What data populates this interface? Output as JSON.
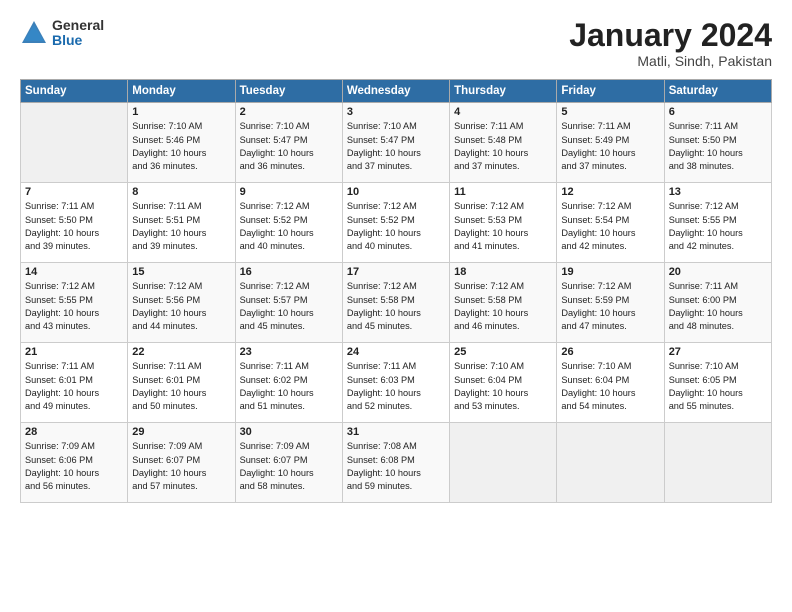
{
  "logo": {
    "general": "General",
    "blue": "Blue"
  },
  "title": "January 2024",
  "location": "Matli, Sindh, Pakistan",
  "days_header": [
    "Sunday",
    "Monday",
    "Tuesday",
    "Wednesday",
    "Thursday",
    "Friday",
    "Saturday"
  ],
  "weeks": [
    [
      {
        "day": "",
        "info": ""
      },
      {
        "day": "1",
        "info": "Sunrise: 7:10 AM\nSunset: 5:46 PM\nDaylight: 10 hours\nand 36 minutes."
      },
      {
        "day": "2",
        "info": "Sunrise: 7:10 AM\nSunset: 5:47 PM\nDaylight: 10 hours\nand 36 minutes."
      },
      {
        "day": "3",
        "info": "Sunrise: 7:10 AM\nSunset: 5:47 PM\nDaylight: 10 hours\nand 37 minutes."
      },
      {
        "day": "4",
        "info": "Sunrise: 7:11 AM\nSunset: 5:48 PM\nDaylight: 10 hours\nand 37 minutes."
      },
      {
        "day": "5",
        "info": "Sunrise: 7:11 AM\nSunset: 5:49 PM\nDaylight: 10 hours\nand 37 minutes."
      },
      {
        "day": "6",
        "info": "Sunrise: 7:11 AM\nSunset: 5:50 PM\nDaylight: 10 hours\nand 38 minutes."
      }
    ],
    [
      {
        "day": "7",
        "info": "Sunrise: 7:11 AM\nSunset: 5:50 PM\nDaylight: 10 hours\nand 39 minutes."
      },
      {
        "day": "8",
        "info": "Sunrise: 7:11 AM\nSunset: 5:51 PM\nDaylight: 10 hours\nand 39 minutes."
      },
      {
        "day": "9",
        "info": "Sunrise: 7:12 AM\nSunset: 5:52 PM\nDaylight: 10 hours\nand 40 minutes."
      },
      {
        "day": "10",
        "info": "Sunrise: 7:12 AM\nSunset: 5:52 PM\nDaylight: 10 hours\nand 40 minutes."
      },
      {
        "day": "11",
        "info": "Sunrise: 7:12 AM\nSunset: 5:53 PM\nDaylight: 10 hours\nand 41 minutes."
      },
      {
        "day": "12",
        "info": "Sunrise: 7:12 AM\nSunset: 5:54 PM\nDaylight: 10 hours\nand 42 minutes."
      },
      {
        "day": "13",
        "info": "Sunrise: 7:12 AM\nSunset: 5:55 PM\nDaylight: 10 hours\nand 42 minutes."
      }
    ],
    [
      {
        "day": "14",
        "info": "Sunrise: 7:12 AM\nSunset: 5:55 PM\nDaylight: 10 hours\nand 43 minutes."
      },
      {
        "day": "15",
        "info": "Sunrise: 7:12 AM\nSunset: 5:56 PM\nDaylight: 10 hours\nand 44 minutes."
      },
      {
        "day": "16",
        "info": "Sunrise: 7:12 AM\nSunset: 5:57 PM\nDaylight: 10 hours\nand 45 minutes."
      },
      {
        "day": "17",
        "info": "Sunrise: 7:12 AM\nSunset: 5:58 PM\nDaylight: 10 hours\nand 45 minutes."
      },
      {
        "day": "18",
        "info": "Sunrise: 7:12 AM\nSunset: 5:58 PM\nDaylight: 10 hours\nand 46 minutes."
      },
      {
        "day": "19",
        "info": "Sunrise: 7:12 AM\nSunset: 5:59 PM\nDaylight: 10 hours\nand 47 minutes."
      },
      {
        "day": "20",
        "info": "Sunrise: 7:11 AM\nSunset: 6:00 PM\nDaylight: 10 hours\nand 48 minutes."
      }
    ],
    [
      {
        "day": "21",
        "info": "Sunrise: 7:11 AM\nSunset: 6:01 PM\nDaylight: 10 hours\nand 49 minutes."
      },
      {
        "day": "22",
        "info": "Sunrise: 7:11 AM\nSunset: 6:01 PM\nDaylight: 10 hours\nand 50 minutes."
      },
      {
        "day": "23",
        "info": "Sunrise: 7:11 AM\nSunset: 6:02 PM\nDaylight: 10 hours\nand 51 minutes."
      },
      {
        "day": "24",
        "info": "Sunrise: 7:11 AM\nSunset: 6:03 PM\nDaylight: 10 hours\nand 52 minutes."
      },
      {
        "day": "25",
        "info": "Sunrise: 7:10 AM\nSunset: 6:04 PM\nDaylight: 10 hours\nand 53 minutes."
      },
      {
        "day": "26",
        "info": "Sunrise: 7:10 AM\nSunset: 6:04 PM\nDaylight: 10 hours\nand 54 minutes."
      },
      {
        "day": "27",
        "info": "Sunrise: 7:10 AM\nSunset: 6:05 PM\nDaylight: 10 hours\nand 55 minutes."
      }
    ],
    [
      {
        "day": "28",
        "info": "Sunrise: 7:09 AM\nSunset: 6:06 PM\nDaylight: 10 hours\nand 56 minutes."
      },
      {
        "day": "29",
        "info": "Sunrise: 7:09 AM\nSunset: 6:07 PM\nDaylight: 10 hours\nand 57 minutes."
      },
      {
        "day": "30",
        "info": "Sunrise: 7:09 AM\nSunset: 6:07 PM\nDaylight: 10 hours\nand 58 minutes."
      },
      {
        "day": "31",
        "info": "Sunrise: 7:08 AM\nSunset: 6:08 PM\nDaylight: 10 hours\nand 59 minutes."
      },
      {
        "day": "",
        "info": ""
      },
      {
        "day": "",
        "info": ""
      },
      {
        "day": "",
        "info": ""
      }
    ]
  ]
}
